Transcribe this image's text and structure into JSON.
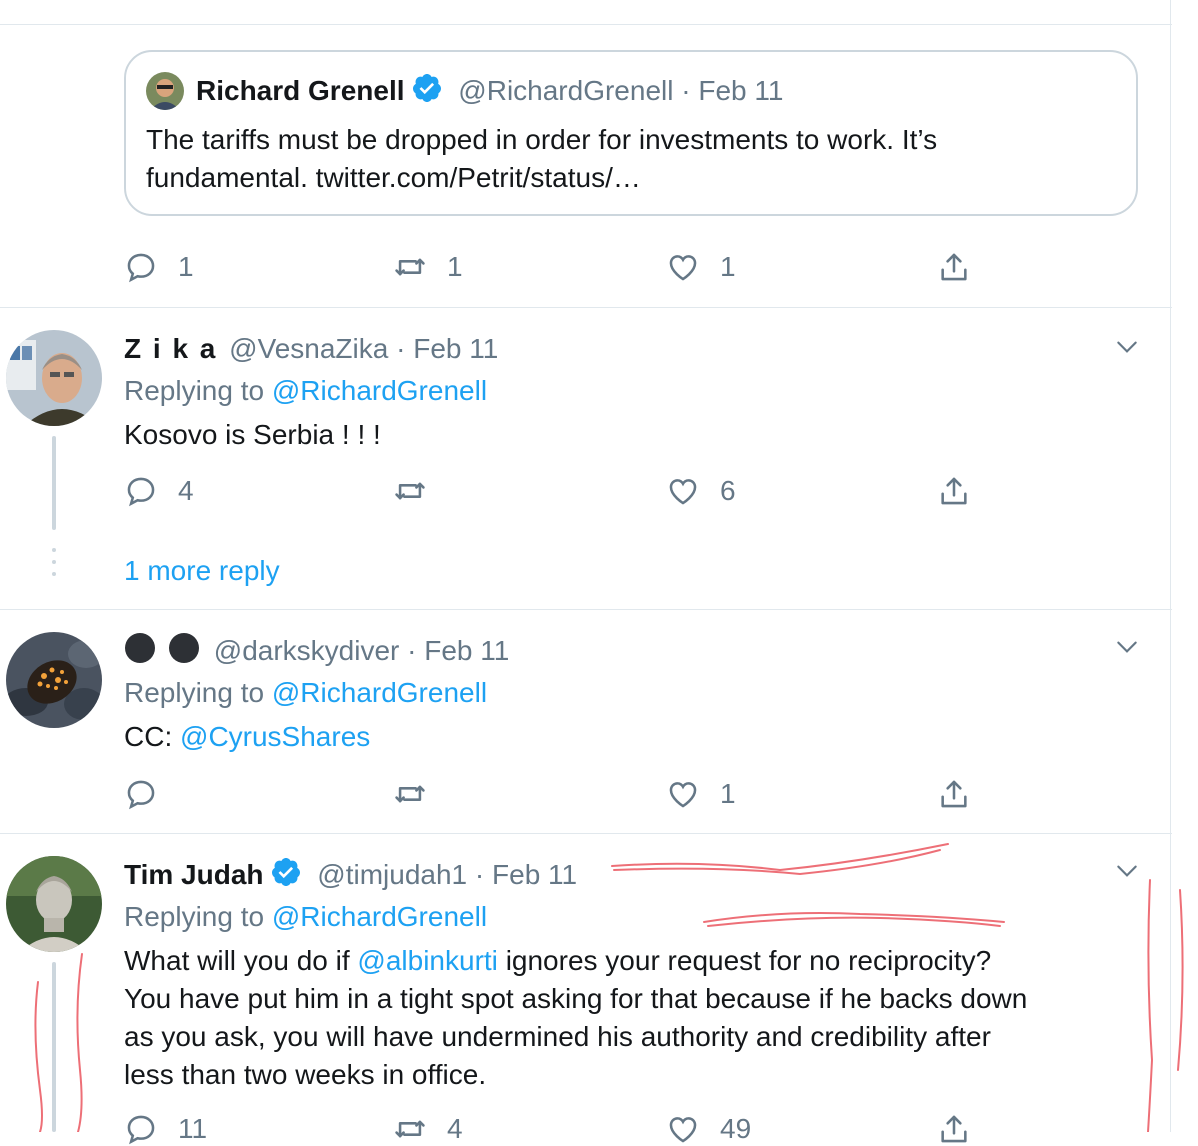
{
  "quote": {
    "name": "Richard Grenell",
    "handle": "@RichardGrenell",
    "date": "· Feb 11",
    "text_line1": "The tariffs must be dropped in order for investments to work. It’s",
    "text_line2": "fundamental. twitter.com/Petrit/status/…"
  },
  "parent_actions": {
    "replies": "1",
    "retweets": "1",
    "likes": "1"
  },
  "tweets": [
    {
      "name": "Z i k a",
      "handle": "@VesnaZika",
      "date": "· Feb 11",
      "replying_prefix": "Replying to",
      "replying_to": "@RichardGrenell",
      "text": "Kosovo is Serbia ! ! !",
      "replies": "4",
      "retweets": "",
      "likes": "6",
      "more_replies": "1 more reply"
    },
    {
      "name": "",
      "handle": "@darkskydiver",
      "date": "· Feb 11",
      "replying_prefix": "Replying to",
      "replying_to": "@RichardGrenell",
      "text_prefix": "CC:",
      "text_mention": "@CyrusShares",
      "replies": "",
      "retweets": "",
      "likes": "1"
    },
    {
      "name": "Tim Judah",
      "handle": "@timjudah1",
      "date": "· Feb 11",
      "replying_prefix": "Replying to",
      "replying_to": "@RichardGrenell",
      "text_l1_prefix": "What will you do if",
      "text_l1_mention": "@albinkurti",
      "text_l1_suffix": "ignores your request for no reciprocity?",
      "text_l2": "You have put him in a tight spot asking for that because if he backs down",
      "text_l3": "as you ask, you will have undermined his authority and credibility after",
      "text_l4": "less than two weeks in office.",
      "replies": "11",
      "retweets": "4",
      "likes": "49"
    }
  ],
  "colors": {
    "accent": "#1da1f2",
    "muted": "#657786",
    "divider": "#e1e8ed",
    "verified": "#1da1f2",
    "scribble": "#e8404a"
  },
  "icons": [
    "reply-icon",
    "retweet-icon",
    "like-icon",
    "share-icon",
    "chevron-down-icon",
    "verified-badge-icon"
  ]
}
